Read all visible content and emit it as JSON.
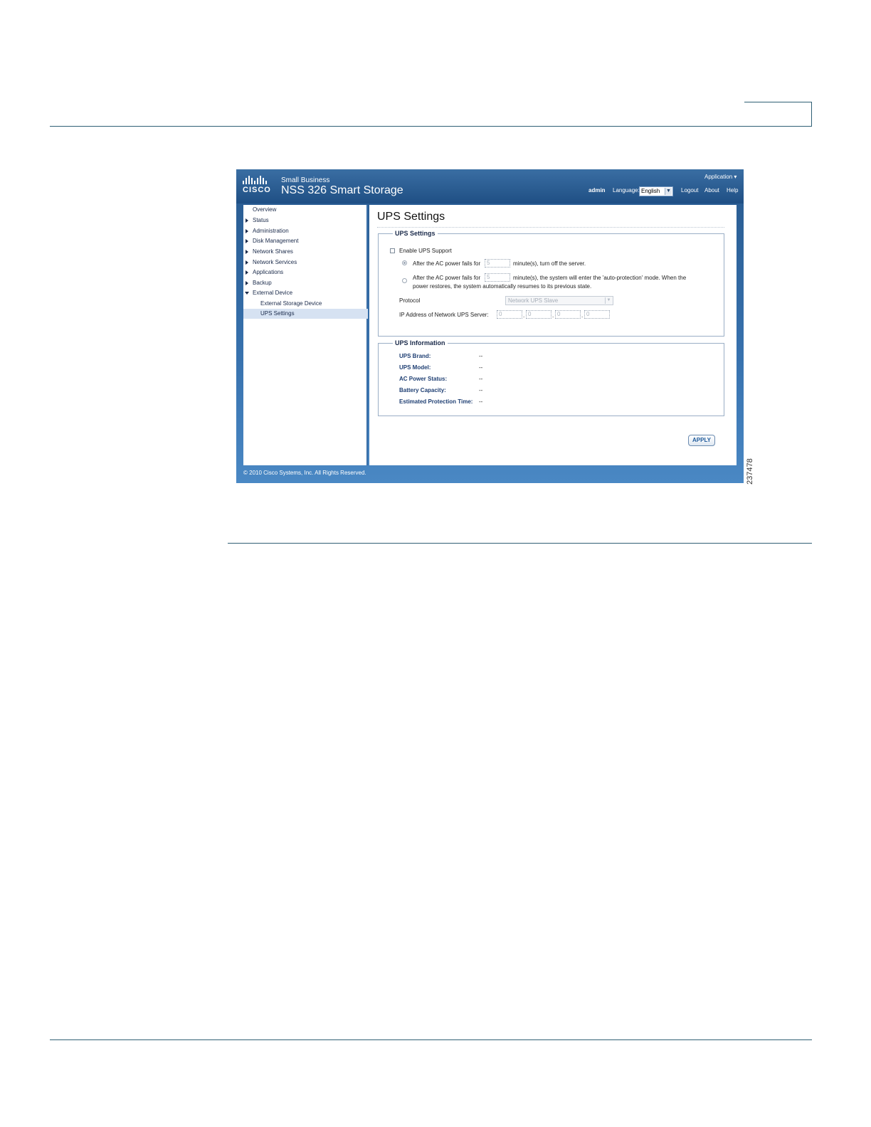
{
  "figure": {
    "id": "237478"
  },
  "app": {
    "brand_small": "Small Business",
    "brand_title": "NSS 326 Smart Storage",
    "logo_text": "CISCO",
    "application_menu": "Application ▾",
    "user": "admin",
    "language_label": "Language:",
    "language_value": "English",
    "logout": "Logout",
    "about": "About",
    "help": "Help"
  },
  "sidebar": {
    "items": [
      {
        "label": "Overview"
      },
      {
        "label": "Status"
      },
      {
        "label": "Administration"
      },
      {
        "label": "Disk Management"
      },
      {
        "label": "Network Shares"
      },
      {
        "label": "Network Services"
      },
      {
        "label": "Applications"
      },
      {
        "label": "Backup"
      },
      {
        "label": "External Device"
      },
      {
        "label": "External Storage Device"
      },
      {
        "label": "UPS Settings"
      }
    ]
  },
  "content": {
    "page_title": "UPS Settings",
    "ups_settings": {
      "legend": "UPS Settings",
      "enable_label": "Enable UPS Support",
      "enable_checked": false,
      "option1_prefix": "After the AC power fails for",
      "option1_value": "5",
      "option1_suffix": "minute(s), turn off the server.",
      "option2_prefix": "After the AC power fails for",
      "option2_value": "5",
      "option2_suffix": "minute(s), the system will enter the 'auto-protection' mode. When the",
      "option2_line2": "power restores, the system automatically resumes to its previous state.",
      "protocol_label": "Protocol",
      "protocol_value": "Network UPS Slave",
      "ip_label": "IP Address of Network UPS Server:",
      "ip": [
        "0",
        "0",
        "0",
        "0"
      ],
      "ip_separator": "."
    },
    "ups_information": {
      "legend": "UPS Information",
      "rows": [
        {
          "label": "UPS Brand:",
          "value": "--"
        },
        {
          "label": "UPS Model:",
          "value": "--"
        },
        {
          "label": "AC Power Status:",
          "value": "--"
        },
        {
          "label": "Battery Capacity:",
          "value": "--"
        },
        {
          "label": "Estimated Protection Time:",
          "value": "--"
        }
      ]
    },
    "apply_label": "APPLY"
  },
  "footer": {
    "copyright": "© 2010 Cisco Systems, Inc. All Rights Reserved."
  }
}
